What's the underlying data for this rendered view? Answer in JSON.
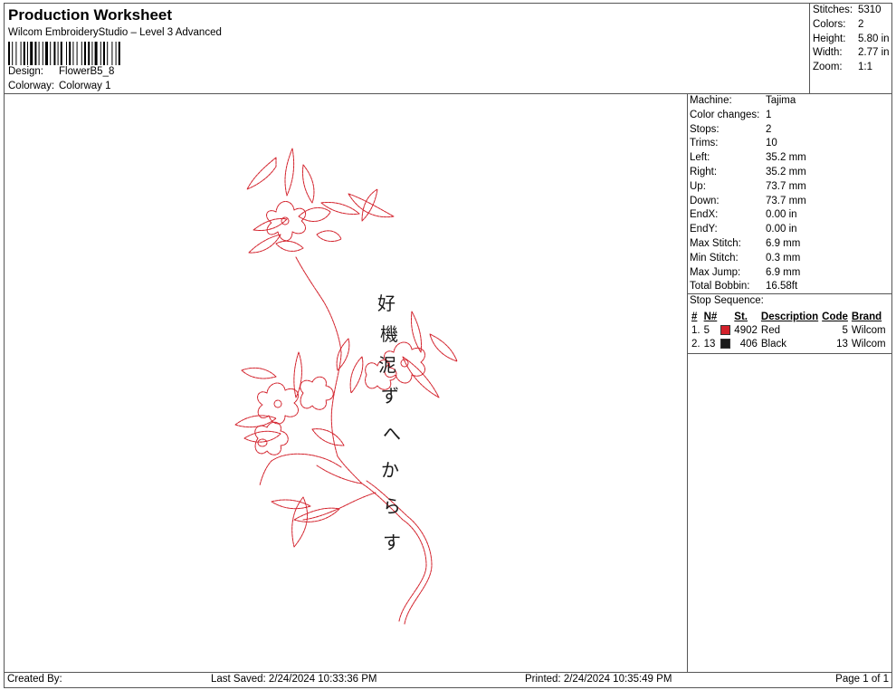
{
  "header": {
    "title": "Production Worksheet",
    "subtitle": "Wilcom EmbroideryStudio – Level 3 Advanced",
    "design_label": "Design:",
    "design_value": "FlowerB5_8",
    "colorway_label": "Colorway:",
    "colorway_value": "Colorway 1"
  },
  "summary": {
    "stitches_label": "Stitches:",
    "stitches": "5310",
    "colors_label": "Colors:",
    "colors": "2",
    "height_label": "Height:",
    "height": "5.80 in",
    "width_label": "Width:",
    "width": "2.77 in",
    "zoom_label": "Zoom:",
    "zoom": "1:1"
  },
  "details": {
    "machine_label": "Machine:",
    "machine": "Tajima",
    "color_changes_label": "Color changes:",
    "color_changes": "1",
    "stops_label": "Stops:",
    "stops": "2",
    "trims_label": "Trims:",
    "trims": "10",
    "left_label": "Left:",
    "left": "35.2 mm",
    "right_label": "Right:",
    "right": "35.2 mm",
    "up_label": "Up:",
    "up": "73.7 mm",
    "down_label": "Down:",
    "down": "73.7 mm",
    "endx_label": "EndX:",
    "endx": "0.00 in",
    "endy_label": "EndY:",
    "endy": "0.00 in",
    "max_stitch_label": "Max Stitch:",
    "max_stitch": "6.9 mm",
    "min_stitch_label": "Min Stitch:",
    "min_stitch": "0.3 mm",
    "max_jump_label": "Max Jump:",
    "max_jump": "6.9 mm",
    "total_bobbin_label": "Total Bobbin:",
    "total_bobbin": "16.58ft",
    "stop_sequence_label": "Stop Sequence:"
  },
  "stop_sequence": {
    "headers": [
      "#",
      "N#",
      "St.",
      "Description",
      "Code",
      "Brand"
    ],
    "rows": [
      {
        "num": "1.",
        "n": "5",
        "color": "#d3212b",
        "st": "4902",
        "desc": "Red",
        "code": "5",
        "brand": "Wilcom"
      },
      {
        "num": "2.",
        "n": "13",
        "color": "#1a1a1a",
        "st": "406",
        "desc": "Black",
        "code": "13",
        "brand": "Wilcom"
      }
    ]
  },
  "design_text": [
    "好",
    "機",
    "泥",
    "ず",
    "へ",
    "か",
    "ら",
    "す"
  ],
  "footer": {
    "created_by": "Created By:",
    "last_saved": "Last Saved: 2/24/2024 10:33:36 PM",
    "printed": "Printed: 2/24/2024 10:35:49 PM",
    "page": "Page 1 of 1"
  },
  "colors": {
    "thread_red": "#d3212b",
    "thread_black": "#1a1a1a"
  }
}
